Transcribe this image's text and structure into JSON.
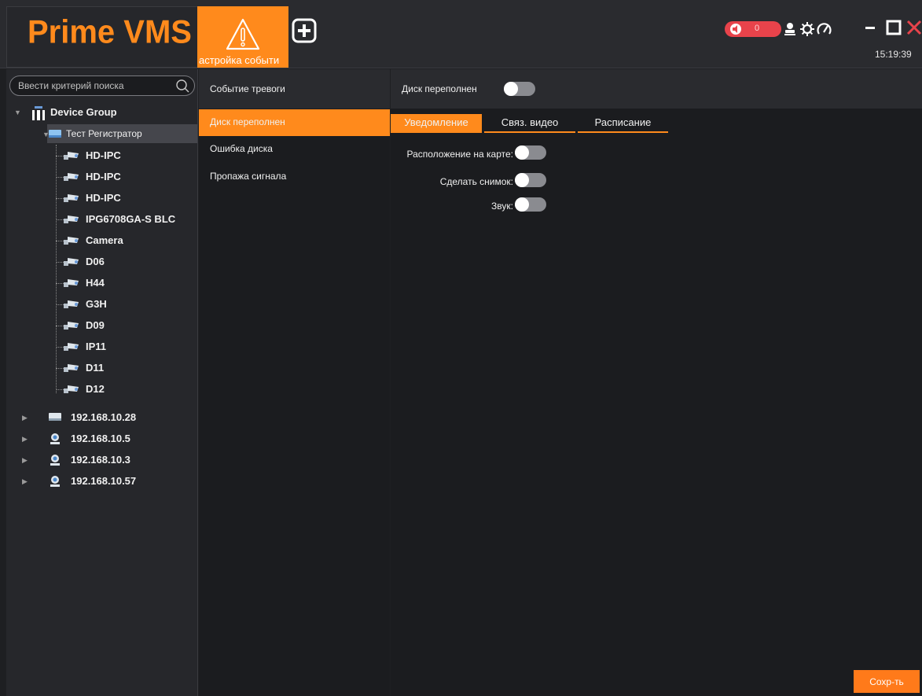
{
  "app": {
    "logo": "Prime VMS",
    "clock": "15:19:39"
  },
  "topbar": {
    "event_tab_label": "астройка событи",
    "alarm_count": "0"
  },
  "search": {
    "placeholder": "Ввести критерий поиска"
  },
  "tree": {
    "root": "Device Group",
    "recorder": "Тест Регистратор",
    "cameras": [
      "HD-IPC",
      "HD-IPC",
      "HD-IPC",
      "IPG6708GA-S BLC",
      "Camera",
      "D06",
      "H44",
      "G3H",
      "D09",
      "IP11",
      "D11",
      "D12"
    ],
    "others": [
      "192.168.10.28",
      "192.168.10.5",
      "192.168.10.3",
      "192.168.10.57"
    ]
  },
  "events": {
    "header": "Событие тревоги",
    "items": [
      "Диск переполнен",
      "Ошибка диска",
      "Пропажа сигнала"
    ]
  },
  "settings": {
    "title": "Диск переполнен",
    "tabs": [
      "Уведомление",
      "Связ. видео",
      "Расписание"
    ],
    "options": [
      "Расположение на карте:",
      "Сделать снимок:",
      "Звук:"
    ],
    "save": "Сохр-ть"
  },
  "colors": {
    "accent": "#ff8a1c",
    "alarm": "#e8434b",
    "panel": "#26272b",
    "content": "#1b1c1f"
  }
}
